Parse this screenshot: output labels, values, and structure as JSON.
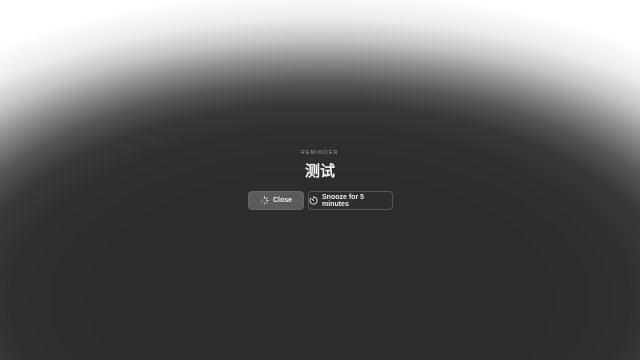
{
  "reminder": {
    "kicker": "REMINDER",
    "title": "测试"
  },
  "actions": {
    "close": {
      "label": "Close",
      "icon": "loading-spinner-icon"
    },
    "snooze": {
      "label": "Snooze for 5 minutes",
      "icon": "timer-icon"
    }
  },
  "colors": {
    "background_dark": "#2c2c2c",
    "background_light": "#ffffff",
    "close_button_bg": "#5b5b5b",
    "snooze_button_bg": "#2e2e2e",
    "text": "#f2f2f2"
  }
}
